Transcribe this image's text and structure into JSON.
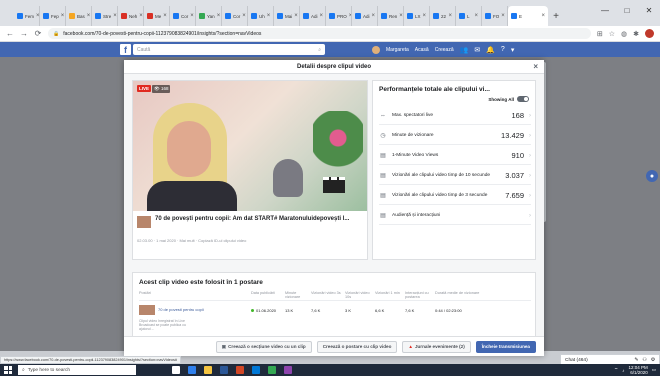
{
  "browser": {
    "tabs": [
      {
        "label": "Fem",
        "color": "#1877f2"
      },
      {
        "label": "Fep",
        "color": "#1877f2"
      },
      {
        "label": "Bas",
        "color": "#f5a623"
      },
      {
        "label": "Stre",
        "color": "#1877f2"
      },
      {
        "label": "Neh",
        "color": "#d93025"
      },
      {
        "label": "Me",
        "color": "#d93025"
      },
      {
        "label": "Cor",
        "color": "#1877f2"
      },
      {
        "label": "Yan",
        "color": "#34a853"
      },
      {
        "label": "Cor",
        "color": "#1877f2"
      },
      {
        "label": "Uh",
        "color": "#1877f2"
      },
      {
        "label": "Mai",
        "color": "#1877f2"
      },
      {
        "label": "Adi",
        "color": "#1877f2"
      },
      {
        "label": "PRO",
        "color": "#1877f2"
      },
      {
        "label": "Adi",
        "color": "#1877f2"
      },
      {
        "label": "Ren",
        "color": "#1877f2"
      },
      {
        "label": "LX",
        "color": "#1877f2"
      },
      {
        "label": "22",
        "color": "#1877f2"
      },
      {
        "label": "L",
        "color": "#1877f2"
      },
      {
        "label": "FO",
        "color": "#1877f2"
      }
    ],
    "active_tab": {
      "label": "E",
      "color": "#1877f2"
    },
    "url": "facebook.com/70-de-povesti-pentru-copii-112379083824901/insights/?section=navVideos",
    "new_tab_icon": "plus-icon",
    "window_controls": [
      "—",
      "□",
      "✕"
    ]
  },
  "facebook": {
    "search_placeholder": "Caută",
    "user_name": "Margareta",
    "nav_items": [
      "Acasă",
      "Creează"
    ]
  },
  "modal": {
    "title": "Detalii despre clipul video",
    "video": {
      "live_badge": "LIVE",
      "viewers_badge": "👁 168",
      "title": "70 de povești pentru copii: Am dat START# Maratonuluidepovești l...",
      "meta": "02.03.00 · 1 mai 2020 · Mai mult · Copiază ID-ul clipului video"
    },
    "performance": {
      "title": "Performanțele totale ale clipului vi...",
      "showing_all_label": "Showing All",
      "metrics": [
        {
          "icon": "peak-viewers-icon",
          "glyph": "⇔",
          "label": "Max. spectatori live",
          "value": "168"
        },
        {
          "icon": "clock-icon",
          "glyph": "◷",
          "label": "Minute de vizionare",
          "value": "13.429"
        },
        {
          "icon": "views-icon",
          "glyph": "▤",
          "label": "1-Minute Video Views",
          "value": "910"
        },
        {
          "icon": "views-icon",
          "glyph": "▤",
          "label": "Vizionări ale clipului video timp de 10 secunde",
          "value": "3.037"
        },
        {
          "icon": "views-icon",
          "glyph": "▤",
          "label": "Vizionări ale clipului video timp de 3 secunde",
          "value": "7.659"
        },
        {
          "icon": "audience-icon",
          "glyph": "▤",
          "label": "Audiență și interacțiuni",
          "value": ""
        }
      ]
    },
    "posts": {
      "title": "Acest clip video este folosit în 1 postare",
      "headers": [
        "Postări",
        "Data publicării",
        "Minute vizionare",
        "Vizionări video 3s",
        "Vizionări video 10s",
        "Vizionări 1 min",
        "Interacțiuni cu postarea",
        "Durată medie de vizionare"
      ],
      "rows": [
        {
          "title": "70 de povesti pentru copii",
          "date": "01.06.2020",
          "cells": [
            "13 K",
            "7,6 K",
            "3 K",
            "6,6 K",
            "7,6 K",
            "0:44 / 02:23:00"
          ]
        }
      ],
      "side_note": "Clipul video înregistrat în Live Broadcast se poate publica cu ajutorul ..."
    },
    "footer_buttons": [
      {
        "icon": "camera-icon",
        "glyph": "▣",
        "label": "Creează o secțiune video cu un clip",
        "variant": "default"
      },
      {
        "icon": "",
        "glyph": "",
        "label": "Creează o postare cu clip video",
        "variant": "default"
      },
      {
        "icon": "warning-icon",
        "glyph": "▲",
        "label": "Jurnale evenimente (2)",
        "variant": "warn"
      },
      {
        "icon": "",
        "glyph": "",
        "label": "Încheie transmisiunea",
        "variant": "primary"
      }
    ]
  },
  "chat": {
    "label": "Chat (464)"
  },
  "status_url": "https://www.facebook.com/70-de-povesti-pentru-copii-112379083824901/insights/?section=navVideos#",
  "taskbar": {
    "search_placeholder": "Type here to search",
    "time": "12:04 PM",
    "date": "6/1/2020",
    "apps": [
      {
        "name": "task-view-icon",
        "color": "#ffffff"
      },
      {
        "name": "edge-icon",
        "color": "#2f80ed"
      },
      {
        "name": "explorer-icon",
        "color": "#f5c542"
      },
      {
        "name": "word-icon",
        "color": "#2b5797"
      },
      {
        "name": "powerpoint-icon",
        "color": "#d24726"
      },
      {
        "name": "photos-icon",
        "color": "#0078d7"
      },
      {
        "name": "chrome-icon",
        "color": "#34a853"
      },
      {
        "name": "app-icon",
        "color": "#8e44ad"
      }
    ]
  }
}
